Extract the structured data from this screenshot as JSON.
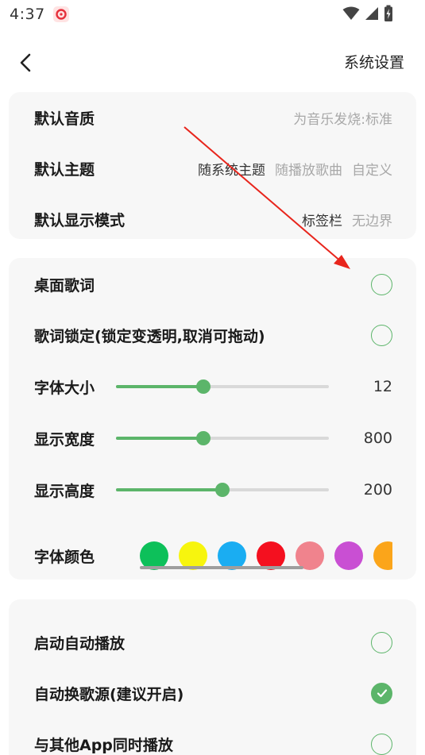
{
  "status_bar": {
    "time": "4:37"
  },
  "header": {
    "title": "系统设置"
  },
  "quality_section": {
    "rows": [
      {
        "label": "默认音质",
        "options": [
          {
            "text": "为音乐发烧:标准",
            "selected": false
          }
        ]
      },
      {
        "label": "默认主题",
        "options": [
          {
            "text": "随系统主题",
            "selected": true
          },
          {
            "text": "随播放歌曲",
            "selected": false
          },
          {
            "text": "自定义",
            "selected": false
          }
        ]
      },
      {
        "label": "默认显示模式",
        "options": [
          {
            "text": "标签栏",
            "selected": true
          },
          {
            "text": "无边界",
            "selected": false
          }
        ]
      }
    ]
  },
  "lyrics_section": {
    "desktop_lyrics": {
      "label": "桌面歌词",
      "checked": false
    },
    "lyrics_lock": {
      "label": "歌词锁定(锁定变透明,取消可拖动)",
      "checked": false
    },
    "font_size": {
      "label": "字体大小",
      "value": "12",
      "fraction": 0.41
    },
    "display_width": {
      "label": "显示宽度",
      "value": "800",
      "fraction": 0.41
    },
    "display_height": {
      "label": "显示高度",
      "value": "200",
      "fraction": 0.5
    },
    "font_color": {
      "label": "字体颜色",
      "swatches": [
        "#0dc05a",
        "#f7f50e",
        "#1aadf2",
        "#f4101f",
        "#f0838d",
        "#c94fd3",
        "#fba51a"
      ]
    }
  },
  "playback_section": {
    "autoplay": {
      "label": "启动自动播放",
      "checked": false
    },
    "auto_switch_source": {
      "label": "自动换歌源(建议开启)",
      "checked": true
    },
    "play_with_others": {
      "label": "与其他App同时播放",
      "checked": false
    }
  },
  "colors": {
    "accent": "#5cb56a",
    "card": "#f7f7f7",
    "annotation_arrow": "#e8251c"
  }
}
